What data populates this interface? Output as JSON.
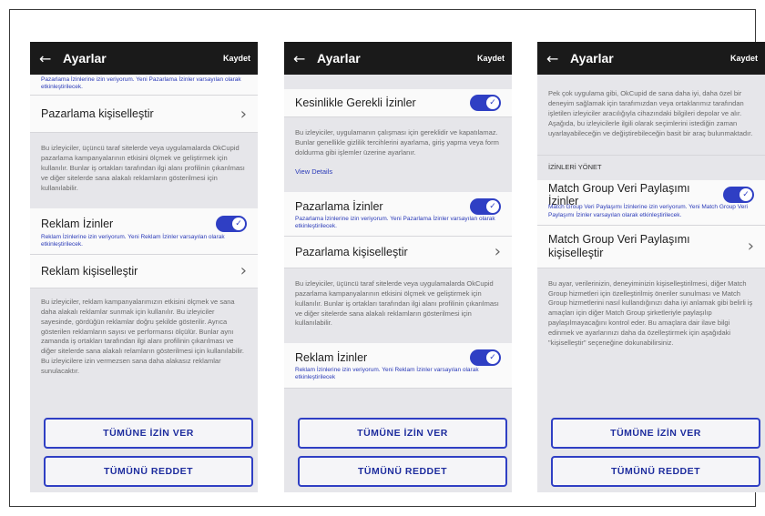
{
  "phones": [
    {
      "header": {
        "title": "Ayarlar",
        "save": "Kaydet"
      },
      "top_cut": "Pazarlama İzinlerine izin veriyorum. Yeni Pazarlama İzinler varsayılan olarak etkinleştirilecek.",
      "row_marketing": "Pazarlama kişiselleştir",
      "desc_marketing": "Bu izleyiciler, üçüncü taraf sitelerde veya uygulamalarda OkCupid pazarlama kampanyalarının etkisini ölçmek ve geliştirmek için kullanılır. Bunlar iş ortakları tarafından ilgi alanı profilinin çıkarılması ve diğer sitelerde sana alakalı reklamların gösterilmesi için kullanılabilir.",
      "row_ads": "Reklam İzinler",
      "sub_ads": "Reklam İzinlerine izin veriyorum. Yeni Reklam İzinler varsayılan olarak etkinleştirilecek.",
      "row_ads_personalize": "Reklam kişiselleştir",
      "desc_ads": "Bu izleyiciler, reklam kampanyalarımızın etkisini ölçmek ve sana daha alakalı reklamlar sunmak için kullanılır. Bu izleyiciler sayesinde, gördüğün reklamlar doğru şekilde gösterilir. Ayrıca gösterilen reklamların sayısı ve performansı ölçülür. Bunlar aynı zamanda iş ortakları tarafından ilgi alanı profilinin çıkarılması ve diğer sitelerde sana alakalı relamların gösterilmesi için kullanılabilir. Bu izleyicilere izin vermezsen sana daha alakasız reklamlar sunulacaktır.",
      "btn_allow": "TÜMÜNE İZİN VER",
      "btn_reject": "TÜMÜNÜ REDDET"
    },
    {
      "header": {
        "title": "Ayarlar",
        "save": "Kaydet"
      },
      "row_required": "Kesinlikle Gerekli İzinler",
      "desc_required": "Bu izleyiciler, uygulamanın çalışması için gereklidir ve kapatılamaz. Bunlar genellikle gizlilik tercihlerini ayarlama, giriş yapma veya form doldurma gibi işlemler üzerine ayarlanır.",
      "view_details": "View Details",
      "row_marketing_perm": "Pazarlama İzinler",
      "sub_marketing": "Pazarlama İzinlerine izin veriyorum. Yeni Pazarlama İzinler varsayılan olarak etkinleştirilecek.",
      "row_marketing": "Pazarlama kişiselleştir",
      "desc_marketing": "Bu izleyiciler, üçüncü taraf sitelerde veya uygulamalarda OkCupid pazarlama kampanyalarının etkisini ölçmek ve geliştirmek için kullanılır. Bunlar iş ortakları tarafından ilgi alanı profilinin çıkarılması ve diğer sitelerde sana alakalı reklamların gösterilmesi için kullanılabilir.",
      "row_ads": "Reklam İzinler",
      "sub_ads": "Reklam İzinlerine izin veriyorum. Yeni Reklam İzinler varsayılan olarak etkinleştirilecek",
      "btn_allow": "TÜMÜNE İZİN VER",
      "btn_reject": "TÜMÜNÜ REDDET"
    },
    {
      "header": {
        "title": "Ayarlar",
        "save": "Kaydet"
      },
      "intro": "Pek çok uygulama gibi, OkCupid de sana daha iyi, daha özel bir deneyim sağlamak için tarafımızdan veya ortaklarımız tarafından işletilen izleyiciler aracılığıyla cihazındaki bilgileri depolar ve alır. Aşağıda, bu izleyicilerle ilgili olarak seçimlerini istediğin zaman uyarlayabileceğin ve değiştirebileceğin basit bir araç bulunmaktadır.",
      "section_manage": "İZİNLERİ YÖNET",
      "row_mg_share": "Match Group Veri Paylaşımı İzinler",
      "sub_mg_share": "Match Group Veri Paylaşımı İzinlerine izin veriyorum. Yeni Match Group Veri Paylaşımı İzinler varsayılan olarak etkinleştirilecek.",
      "row_mg_personalize": "Match Group Veri Paylaşımı kişiselleştir",
      "desc_mg": "Bu ayar, verilerinizin, deneyiminizin kişiselleştirilmesi, diğer Match Group hizmetleri için özelleştirilmiş öneriler sunulması ve Match Group hizmetlerini nasıl kullandığınızı daha iyi anlamak gibi belirli iş amaçları için diğer Match Group şirketleriyle paylaşılıp paylaşılmayacağını kontrol eder. Bu amaçlara dair ilave bilgi edinmek ve ayarlarınızı daha da özelleştirmek için aşağıdaki \"kişiselleştir\" seçeneğine dokunabilirsiniz.",
      "btn_allow": "TÜMÜNE İZİN VER",
      "btn_reject": "TÜMÜNÜ REDDET"
    }
  ],
  "icons": {
    "back": "←",
    "chevron": "›",
    "check": "✓"
  },
  "colors": {
    "accent": "#2f3fc4",
    "topbar": "#1a1a1a",
    "background": "#e6e6ea"
  }
}
